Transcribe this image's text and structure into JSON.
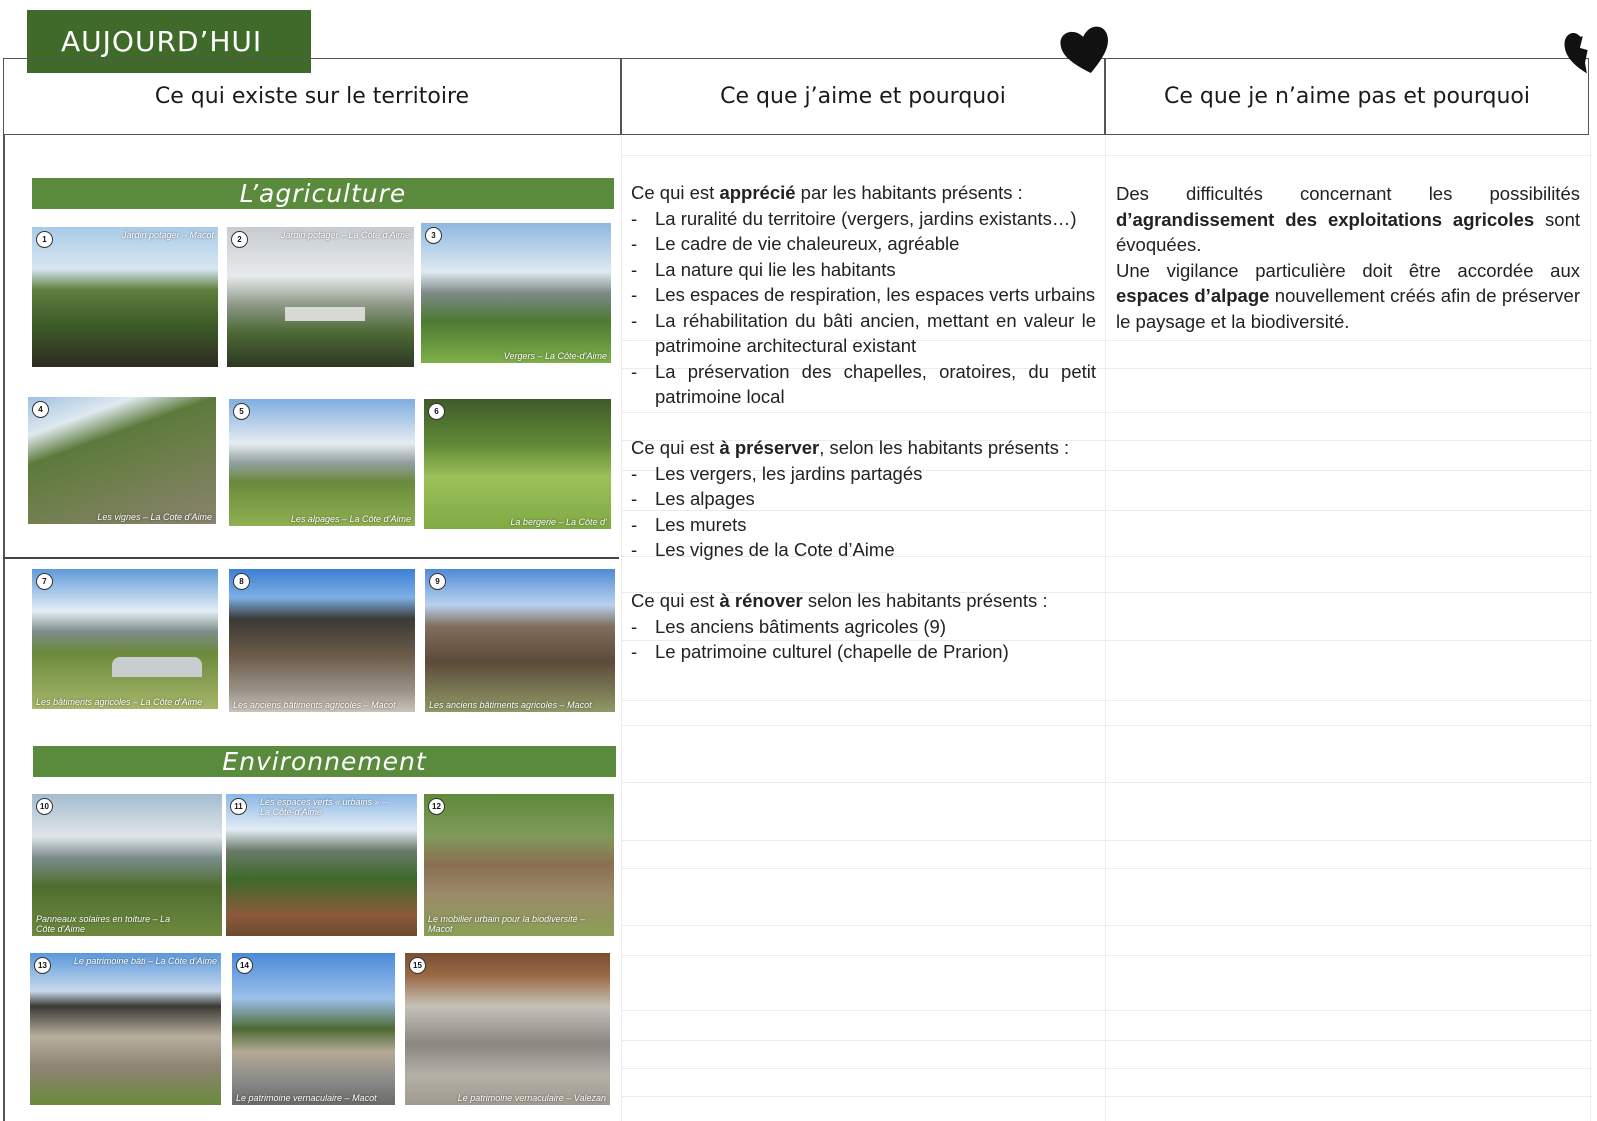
{
  "tag": "AUJOURD’HUI",
  "headers": {
    "col1": "Ce qui existe sur le territoire",
    "col2": "Ce que j’aime et pourquoi",
    "col3": "Ce que je n’aime pas et pourquoi"
  },
  "banners": {
    "agriculture": "L’agriculture",
    "environment": "Environnement"
  },
  "photos": [
    {
      "num": "1",
      "caption": "Jardin potager – Macot"
    },
    {
      "num": "2",
      "caption": "Jardin potager – La Côte d’Aime"
    },
    {
      "num": "3",
      "caption": "Vergers – La Côte-d’Aime"
    },
    {
      "num": "4",
      "caption": "Les vignes – La Cote d’Aime"
    },
    {
      "num": "5",
      "caption": "Les alpages – La Côte d’Aime"
    },
    {
      "num": "6",
      "caption": "La bergerie – La Côte d’"
    },
    {
      "num": "7",
      "caption": "Les bâtiments agricoles – La Côte d’Aime"
    },
    {
      "num": "8",
      "caption": "Les anciens bâtiments agricoles – Macot"
    },
    {
      "num": "9",
      "caption": "Les anciens bâtiments agricoles – Macot"
    },
    {
      "num": "10",
      "caption": "Panneaux solaires en toiture – La Côte d’Aime"
    },
    {
      "num": "11",
      "caption": "Les espaces verts « urbains » – La Côte-d’Aime"
    },
    {
      "num": "12",
      "caption": "Le mobilier urbain pour la biodiversité – Macot"
    },
    {
      "num": "13",
      "caption": "Le patrimoine bâti – La Côte d’Aime"
    },
    {
      "num": "14",
      "caption": "Le patrimoine vernaculaire – Macot"
    },
    {
      "num": "15",
      "caption": "Le patrimoine vernaculaire – Valezan"
    }
  ],
  "likes": {
    "appreciated_pre": "Ce qui est ",
    "appreciated_bold": "apprécié",
    "appreciated_post": " par les habitants présents :",
    "appreciated_items": [
      "La ruralité du territoire (vergers, jardins existants…)",
      "Le cadre de vie chaleureux, agréable",
      "La nature qui lie les habitants",
      "Les espaces de respiration, les espaces verts urbains",
      "La réhabilitation du bâti ancien, mettant en valeur le patrimoine architectural existant",
      "La préservation des chapelles, oratoires, du petit patrimoine local"
    ],
    "preserve_pre": "Ce qui est ",
    "preserve_bold": "à préserver",
    "preserve_post": ", selon les habitants présents :",
    "preserve_items": [
      "Les vergers, les jardins partagés",
      "Les alpages",
      "Les murets",
      "Les vignes de la Cote d’Aime"
    ],
    "renovate_pre": "Ce qui est ",
    "renovate_bold": "à rénover",
    "renovate_post": " selon les habitants présents :",
    "renovate_items": [
      "Les anciens bâtiments agricoles (9)",
      "Le patrimoine culturel (chapelle de Prarion)"
    ]
  },
  "dislikes": {
    "p1_pre": "Des difficultés concernant les possibilités ",
    "p1_bold": "d’agrandissement des exploitations agricoles",
    "p1_post": " sont évoquées.",
    "p2_pre": "Une vigilance particulière doit être accordée aux ",
    "p2_bold": "espaces d’alpage",
    "p2_post": " nouvellement créés afin de préserver le paysage et la biodiversité."
  },
  "colors": {
    "tag_bg": "#3f6a2a",
    "banner_bg": "#5a8a3c"
  },
  "icons": [
    "heart-icon",
    "broken-heart-icon"
  ]
}
